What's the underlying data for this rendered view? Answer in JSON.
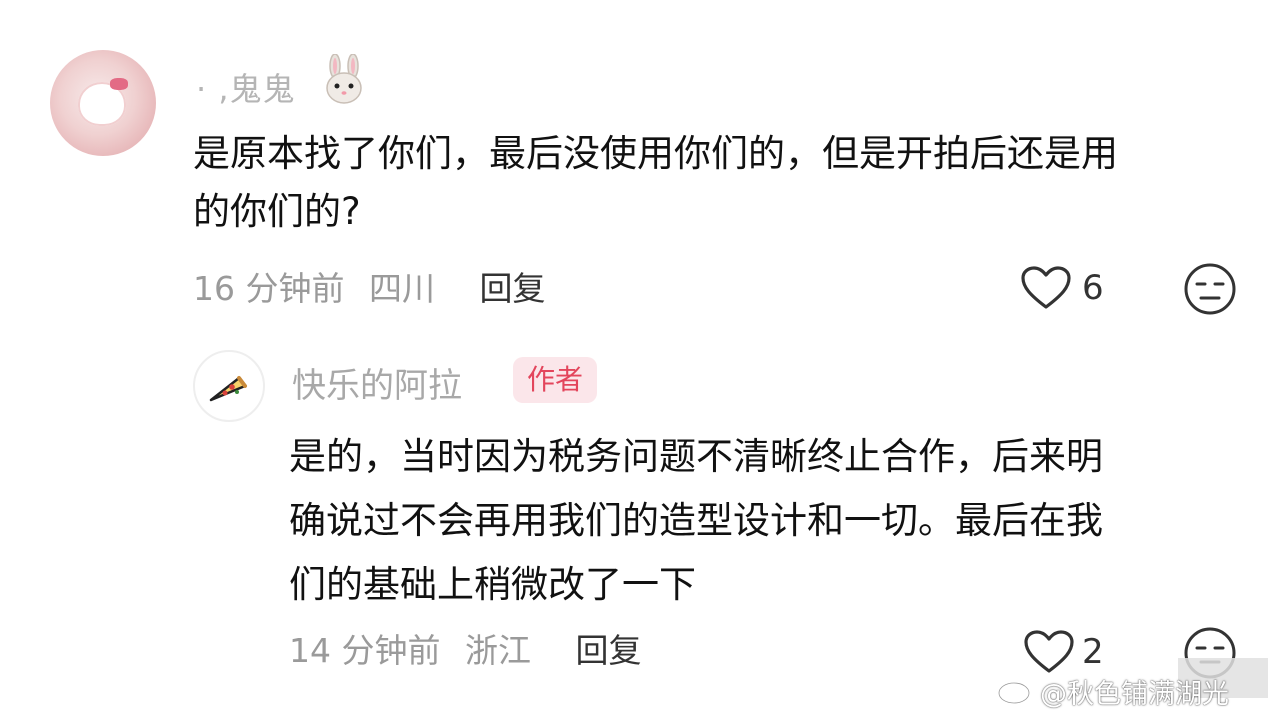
{
  "main_comment": {
    "username": "·  ,鬼鬼",
    "username_emoji": "bunny-emoji",
    "text_line1": "是原本找了你们，最后没使用你们的，但是开拍后还是用",
    "text_line2": "的你们的?",
    "time": "16 分钟前",
    "region": "四川",
    "reply_label": "回复",
    "like_count": "6"
  },
  "reply_comment": {
    "username": "快乐的阿拉",
    "badge": "作者",
    "text_line1": "是的，当时因为税务问题不清晰终止合作，后来明",
    "text_line2": "确说过不会再用我们的造型设计和一切。最后在我",
    "text_line3": "们的基础上稍微改了一下",
    "time": "14 分钟前",
    "region": "浙江",
    "reply_label": "回复",
    "like_count": "2"
  },
  "watermark": {
    "text": "@秋色铺满湖光",
    "icon": "weibo-icon"
  },
  "colors": {
    "badge_bg": "#fbe6ea",
    "badge_text": "#e3455c",
    "meta": "#9a9a9a"
  }
}
